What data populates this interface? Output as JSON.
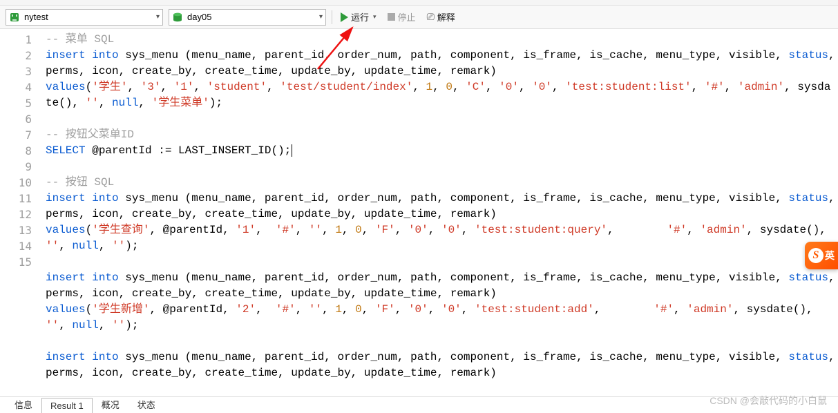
{
  "toolbar": {
    "connection": "nytest",
    "database": "day05",
    "run": "运行",
    "stop": "停止",
    "explain": "解释"
  },
  "icons": {
    "connection_color": "#2e9b3a",
    "database_color": "#2e9b3a"
  },
  "code": {
    "lines": [
      "1",
      "2",
      "3",
      "4",
      "5",
      "6",
      "7",
      "8",
      "9",
      "10",
      "11",
      "12",
      "13",
      "14",
      "15"
    ],
    "cmt_menu": "-- 菜单 SQL",
    "cmt_btn_parent": "-- 按钮父菜单ID",
    "cmt_btn": "-- 按钮 SQL",
    "kw_insert": "insert",
    "kw_into": "into",
    "kw_values": "values",
    "kw_select": "SELECT",
    "kw_null": "null",
    "kw_status": "status",
    "tbl": "sys_menu",
    "cols": "(menu_name, parent_id, order_num, path, component, is_frame, is_cache, menu_type, visible, ",
    "cols_tail": ", perms, icon, create_by, create_time, update_by, update_time, remark)",
    "row1": {
      "v_name": "'学生'",
      "v_parent": "'3'",
      "v_order": "'1'",
      "v_path": "'student'",
      "v_comp": "'test/student/index'",
      "v_isframe": "1",
      "v_iscache": "0",
      "v_type": "'C'",
      "v_visible": "'0'",
      "v_status": "'0'",
      "v_perms": "'test:student:list'",
      "v_icon": "'#'",
      "v_createby": "'admin'",
      "v_sysdate": "sysdate()",
      "v_updateby": "''",
      "v_remark": "'学生菜单'"
    },
    "select_line": "@parentId := LAST_INSERT_ID();",
    "row2": {
      "v_name": "'学生查询'",
      "v_parent": "@parentId",
      "v_order": "'1'",
      "v_path": "'#'",
      "v_comp": "''",
      "v_isframe": "1",
      "v_iscache": "0",
      "v_type": "'F'",
      "v_visible": "'0'",
      "v_status": "'0'",
      "v_perms": "'test:student:query'",
      "v_icon": "'#'",
      "v_createby": "'admin'",
      "v_sysdate": "sysdate()",
      "v_updateby": "''",
      "v_remark": "''"
    },
    "row3": {
      "v_name": "'学生新增'",
      "v_parent": "@parentId",
      "v_order": "'2'",
      "v_path": "'#'",
      "v_comp": "''",
      "v_isframe": "1",
      "v_iscache": "0",
      "v_type": "'F'",
      "v_visible": "'0'",
      "v_status": "'0'",
      "v_perms": "'test:student:add'",
      "v_icon": "'#'",
      "v_createby": "'admin'",
      "v_sysdate": "sysdate()",
      "v_updateby": "''",
      "v_remark": "''"
    }
  },
  "tabs": {
    "info": "信息",
    "result1": "Result 1",
    "profile": "概况",
    "status": "状态"
  },
  "watermark": "CSDN @会敲代码的小白鼠",
  "sogou": {
    "s": "S",
    "y": "英"
  }
}
